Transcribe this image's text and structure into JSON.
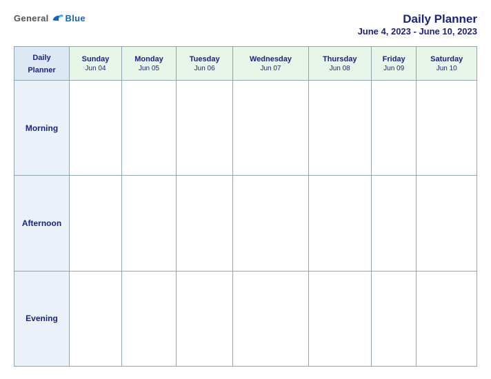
{
  "header": {
    "logo_general": "General",
    "logo_blue": "Blue",
    "title": "Daily Planner",
    "date_range": "June 4, 2023 - June 10, 2023"
  },
  "table": {
    "label_header": "Daily\nPlanner",
    "columns": [
      {
        "day": "Sunday",
        "date": "Jun 04"
      },
      {
        "day": "Monday",
        "date": "Jun 05"
      },
      {
        "day": "Tuesday",
        "date": "Jun 06"
      },
      {
        "day": "Wednesday",
        "date": "Jun 07"
      },
      {
        "day": "Thursday",
        "date": "Jun 08"
      },
      {
        "day": "Friday",
        "date": "Jun 09"
      },
      {
        "day": "Saturday",
        "date": "Jun 10"
      }
    ],
    "periods": [
      "Morning",
      "Afternoon",
      "Evening"
    ]
  }
}
